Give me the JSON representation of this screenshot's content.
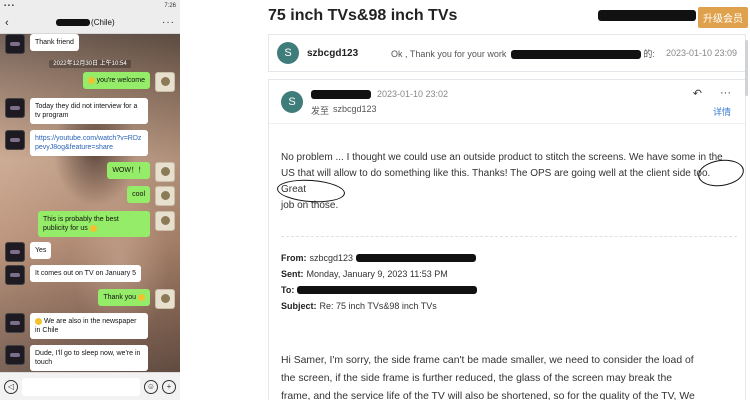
{
  "chat": {
    "status_time": "7:26",
    "header": {
      "title_suffix": "(Chile)",
      "back_icon": "chevron-left-icon",
      "more_icon": "ellipsis-icon"
    },
    "timestamp": "2022年12月30日 上午10:54",
    "messages": [
      {
        "side": "in",
        "text": "Thank friend"
      },
      {
        "side": "out",
        "text": "you're welcome",
        "emoji": true
      },
      {
        "side": "in",
        "text": "Today they did not interview for a tv program"
      },
      {
        "side": "in",
        "text": "https://youtube.com/watch?v=RDzpevyJ8og&feature=share",
        "link": true
      },
      {
        "side": "out",
        "text": "WOW！！"
      },
      {
        "side": "out",
        "text": "cool"
      },
      {
        "side": "out",
        "text": "This is probably the best publicity for us",
        "emoji": true
      },
      {
        "side": "in",
        "text": "Yes"
      },
      {
        "side": "in",
        "text": "It comes out on TV on January 5"
      },
      {
        "side": "out",
        "text": "Thank you",
        "emoji": true
      },
      {
        "side": "in",
        "text": "We are also in the newspaper in Chile",
        "emoji_before": true
      },
      {
        "side": "in",
        "text": "Dude, I'll go to sleep now, we're in touch"
      }
    ]
  },
  "mail": {
    "subject": "75 inch TVs&98 inch TVs",
    "upgrade_label": "升级会员",
    "thread": {
      "avatar_letter": "S",
      "sender": "szbcgd123",
      "snippet": "Ok , Thank you for your work",
      "snippet_tail": "的:",
      "date": "2023-01-10 23:09"
    },
    "message": {
      "avatar_letter": "S",
      "timestamp": "2023-01-10 23:02",
      "to_label": "发至",
      "to": "szbcgd123",
      "detail_label": "详情",
      "reply_icon": "reply-icon",
      "more_icon": "ellipsis-icon",
      "body_line1": "No problem ... I thought we could use an outside product to stitch the screens. We have some in the",
      "body_line2": "US that will allow to do something like this. Thanks! The OPS are going well at the client side too. Great",
      "body_line3": "job on those.",
      "quote": {
        "from_label": "From:",
        "from": "szbcgd123",
        "sent_label": "Sent:",
        "sent": "Monday, January 9, 2023 11:53 PM",
        "to_label": "To:",
        "subject_label": "Subject:",
        "subject": "Re: 75 inch TVs&98 inch TVs"
      },
      "reply_line1": "Hi Samer, I'm sorry, the side frame can't be made smaller, we need to consider the load of",
      "reply_line2": "the screen, if the side frame is further reduced, the glass of the screen may break the",
      "reply_line3": "frame, and the service life of the TV will also be shortened, so for the quality of the TV, We"
    }
  }
}
